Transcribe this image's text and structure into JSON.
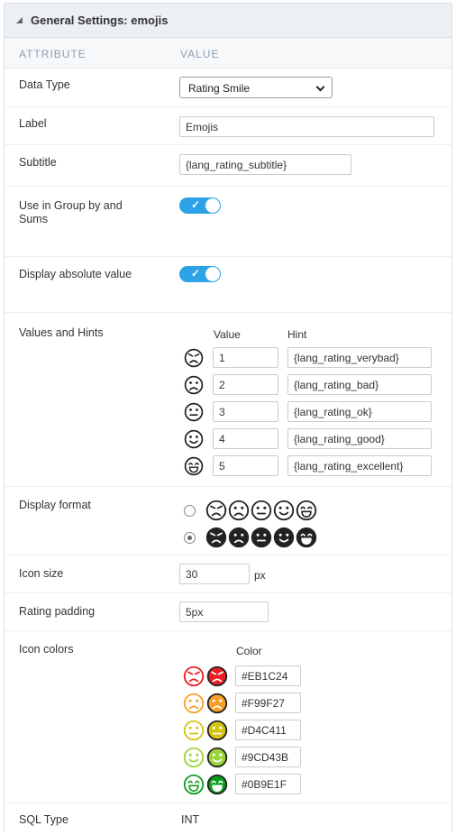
{
  "panel": {
    "title": "General Settings: emojis",
    "col_attribute": "ATTRIBUTE",
    "col_value": "VALUE"
  },
  "fields": {
    "data_type": {
      "label": "Data Type",
      "value": "Rating Smile"
    },
    "label": {
      "label": "Label",
      "value": "Emojis"
    },
    "subtitle": {
      "label": "Subtitle",
      "value": "{lang_rating_subtitle}"
    },
    "group_by": {
      "label_line1": "Use in Group by and",
      "label_line2": "Sums",
      "checked": true
    },
    "absolute": {
      "label": "Display absolute value",
      "checked": true
    },
    "values_hints": {
      "label": "Values and Hints",
      "value_header": "Value",
      "hint_header": "Hint",
      "rows": [
        {
          "icon": "angry-face-icon",
          "value": "1",
          "hint": "{lang_rating_verybad}"
        },
        {
          "icon": "sad-face-icon",
          "value": "2",
          "hint": "{lang_rating_bad}"
        },
        {
          "icon": "neutral-face-icon",
          "value": "3",
          "hint": "{lang_rating_ok}"
        },
        {
          "icon": "smile-face-icon",
          "value": "4",
          "hint": "{lang_rating_good}"
        },
        {
          "icon": "grin-face-icon",
          "value": "5",
          "hint": "{lang_rating_excellent}"
        }
      ]
    },
    "display_format": {
      "label": "Display format",
      "options": [
        {
          "style": "outline",
          "selected": false
        },
        {
          "style": "solid",
          "selected": true
        }
      ]
    },
    "icon_size": {
      "label": "Icon size",
      "value": "30",
      "unit": "px"
    },
    "rating_padding": {
      "label": "Rating padding",
      "value": "5px"
    },
    "icon_colors": {
      "label": "Icon colors",
      "color_header": "Color",
      "rows": [
        {
          "icon": "angry-face-icon",
          "value": "#EB1C24",
          "color": "#EB1C24"
        },
        {
          "icon": "sad-face-icon",
          "value": "#F99F27",
          "color": "#F99F27"
        },
        {
          "icon": "neutral-face-icon",
          "value": "#D4C411",
          "color": "#D4C411"
        },
        {
          "icon": "smile-face-icon",
          "value": "#9CD43B",
          "color": "#9CD43B"
        },
        {
          "icon": "grin-face-icon",
          "value": "#0B9E1F",
          "color": "#0B9E1F"
        }
      ]
    },
    "sql_type": {
      "label": "SQL Type",
      "value": "INT"
    }
  },
  "colors": {
    "toggle_on": "#2ba3e6",
    "header_bg": "#eceff3",
    "column_header_text": "#8aa0b4",
    "face_outline": "#222222"
  }
}
